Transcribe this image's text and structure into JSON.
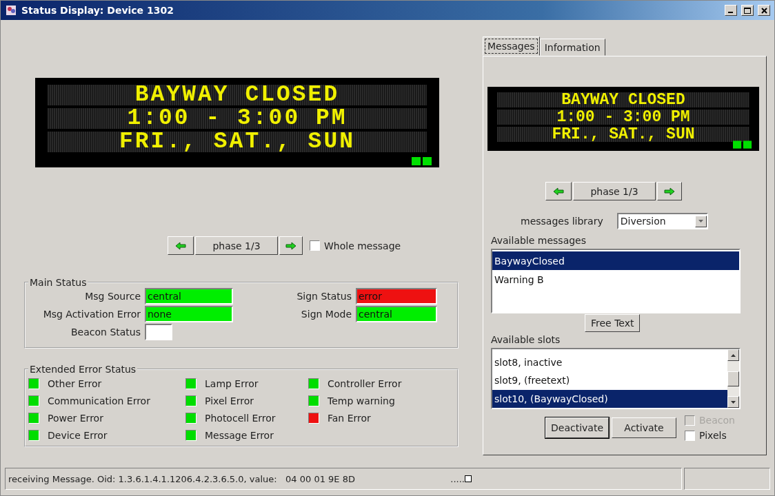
{
  "window": {
    "title": "Status Display: Device 1302"
  },
  "sign": {
    "lines": [
      "BAYWAY CLOSED",
      "1:00 - 3:00 PM",
      "FRI., SAT., SUN"
    ]
  },
  "phase": {
    "label": "phase 1/3",
    "whole_message": {
      "label": "Whole message",
      "checked": false
    }
  },
  "main_status": {
    "title": "Main Status",
    "fields": [
      {
        "label": "Msg Source",
        "value": "central",
        "color": "#00ee00"
      },
      {
        "label": "Sign Status",
        "value": "error",
        "color": "#ee1111"
      },
      {
        "label": "Msg Activation Error",
        "value": "none",
        "color": "#00ee00"
      },
      {
        "label": "Sign Mode",
        "value": "central",
        "color": "#00ee00"
      },
      {
        "label": "Beacon Status",
        "color": "#ffffff"
      }
    ]
  },
  "extended_error_status": {
    "title": "Extended Error Status",
    "columns": [
      [
        {
          "label": "Other Error",
          "color": "#00dd00"
        },
        {
          "label": "Communication Error",
          "color": "#00dd00"
        },
        {
          "label": "Power Error",
          "color": "#00dd00"
        },
        {
          "label": "Device Error",
          "color": "#00dd00"
        }
      ],
      [
        {
          "label": "Lamp Error",
          "color": "#00dd00"
        },
        {
          "label": "Pixel Error",
          "color": "#00dd00"
        },
        {
          "label": "Photocell Error",
          "color": "#00dd00"
        },
        {
          "label": "Message Error",
          "color": "#00dd00"
        }
      ],
      [
        {
          "label": "Controller Error",
          "color": "#00dd00"
        },
        {
          "label": "Temp warning",
          "color": "#00dd00"
        },
        {
          "label": "Fan Error",
          "color": "#ee1111"
        }
      ]
    ]
  },
  "tabs": [
    {
      "label": "Messages",
      "selected": true
    },
    {
      "label": "Information",
      "selected": false
    }
  ],
  "preview_sign": {
    "lines": [
      "BAYWAY CLOSED",
      "1:00 - 3:00 PM",
      "FRI., SAT., SUN"
    ]
  },
  "preview_phase": {
    "label": "phase 1/3"
  },
  "library": {
    "label": "messages library",
    "value": "Diversion"
  },
  "available_messages": {
    "label": "Available messages",
    "items": [
      {
        "text": "BaywayClosed",
        "selected": true
      },
      {
        "text": "Warning B",
        "selected": false
      }
    ]
  },
  "free_text_button": "Free Text",
  "available_slots": {
    "label": "Available slots",
    "items": [
      {
        "text": "slot8, inactive",
        "selected": false
      },
      {
        "text": "slot9, (freetext)",
        "selected": false
      },
      {
        "text": "slot10, (BaywayClosed)",
        "selected": true
      }
    ]
  },
  "buttons": [
    "Deactivate",
    "Activate"
  ],
  "options": [
    {
      "label": "Beacon",
      "checked": false,
      "disabled": true
    },
    {
      "label": "Pixels",
      "checked": false,
      "disabled": false
    }
  ],
  "status_bar": {
    "message": "receiving Message. Oid: 1.3.6.1.4.1.1206.4.2.3.6.5.0, value:   04 00 01 9E 8D",
    "progress": "....."
  }
}
